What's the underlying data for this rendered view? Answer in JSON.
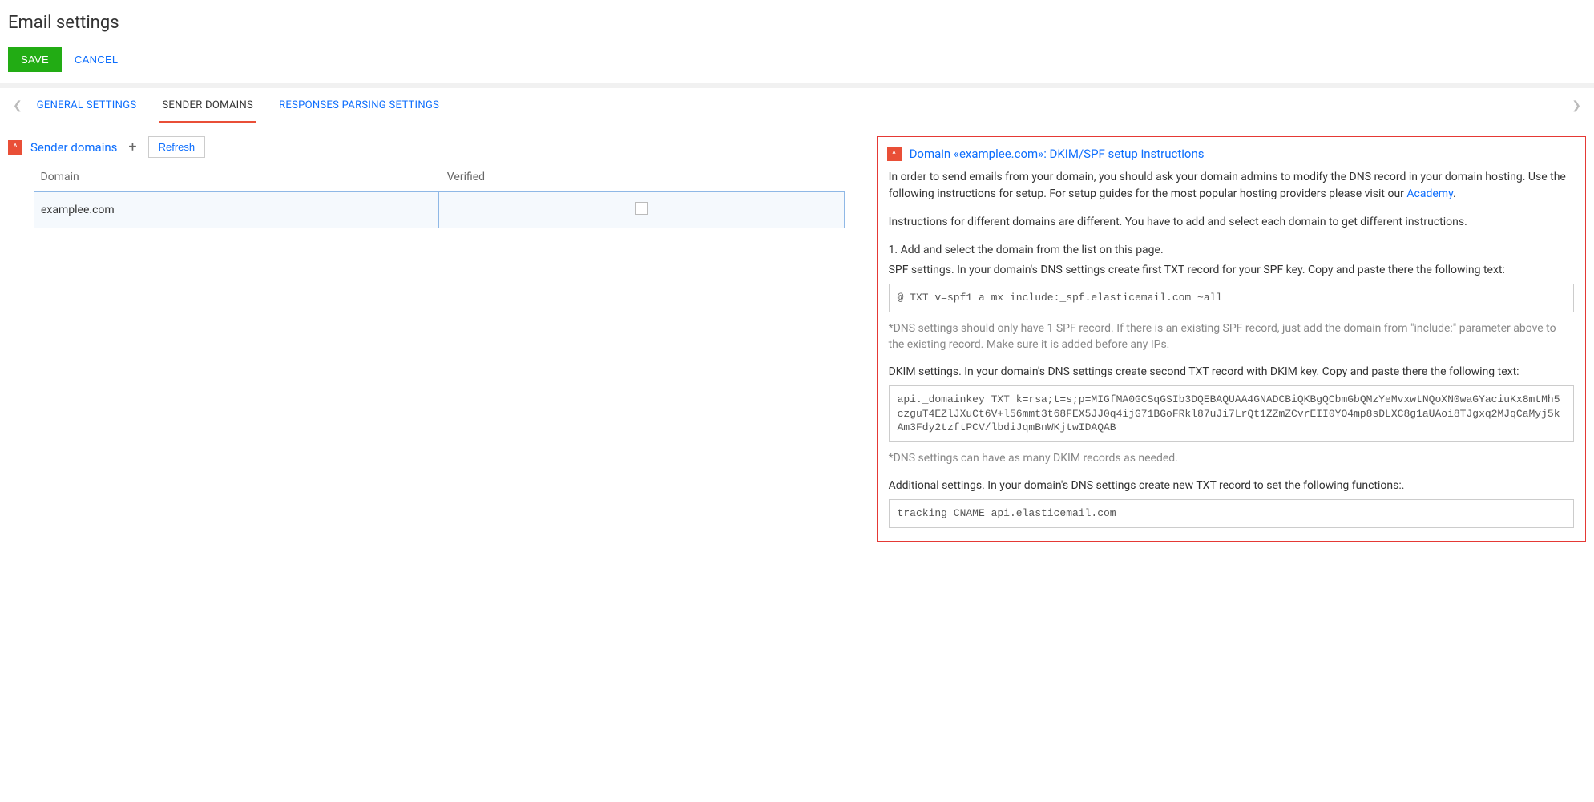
{
  "pageTitle": "Email settings",
  "actions": {
    "save": "SAVE",
    "cancel": "CANCEL"
  },
  "tabs": {
    "general": "GENERAL SETTINGS",
    "sender": "SENDER DOMAINS",
    "responses": "RESPONSES PARSING SETTINGS"
  },
  "senderPanel": {
    "title": "Sender domains",
    "refresh": "Refresh",
    "headers": {
      "domain": "Domain",
      "verified": "Verified"
    },
    "rows": [
      {
        "domain": "examplee.com",
        "verified": false
      }
    ]
  },
  "instructions": {
    "title": "Domain «examplee.com»: DKIM/SPF setup instructions",
    "intro1a": "In order to send emails from your domain, you should ask your domain admins to modify the DNS record in your domain hosting. Use the following instructions for setup. For setup guides for the most popular hosting providers please visit our ",
    "academy": "Academy",
    "intro1b": ".",
    "intro2": "Instructions for different domains are different. You have to add and select each domain to get different instructions.",
    "step1": "1. Add and select the domain from the list on this page.",
    "spfLabel": "SPF settings. In your domain's DNS settings create first TXT record for your SPF key. Copy and paste there the following text:",
    "spfCode": "@ TXT v=spf1 a mx include:_spf.elasticemail.com ~all",
    "spfNote": "*DNS settings should only have 1 SPF record. If there is an existing SPF record, just add the domain from \"include:\" parameter above to the existing record. Make sure it is added before any IPs.",
    "dkimLabel": "DKIM settings. In your domain's DNS settings create second TXT record with DKIM key. Copy and paste there the following text:",
    "dkimCode": "api._domainkey TXT k=rsa;t=s;p=MIGfMA0GCSqGSIb3DQEBAQUAA4GNADCBiQKBgQCbmGbQMzYeMvxwtNQoXN0waGYaciuKx8mtMh5czguT4EZlJXuCt6V+l56mmt3t68FEX5JJ0q4ijG71BGoFRkl87uJi7LrQt1ZZmZCvrEII0YO4mp8sDLXC8g1aUAoi8TJgxq2MJqCaMyj5kAm3Fdy2tzftPCV/lbdiJqmBnWKjtwIDAQAB",
    "dkimNote": "*DNS settings can have as many DKIM records as needed.",
    "additionalLabel": "Additional settings. In your domain's DNS settings create new TXT record to set the following functions:.",
    "additionalCode": "tracking CNAME api.elasticemail.com"
  }
}
